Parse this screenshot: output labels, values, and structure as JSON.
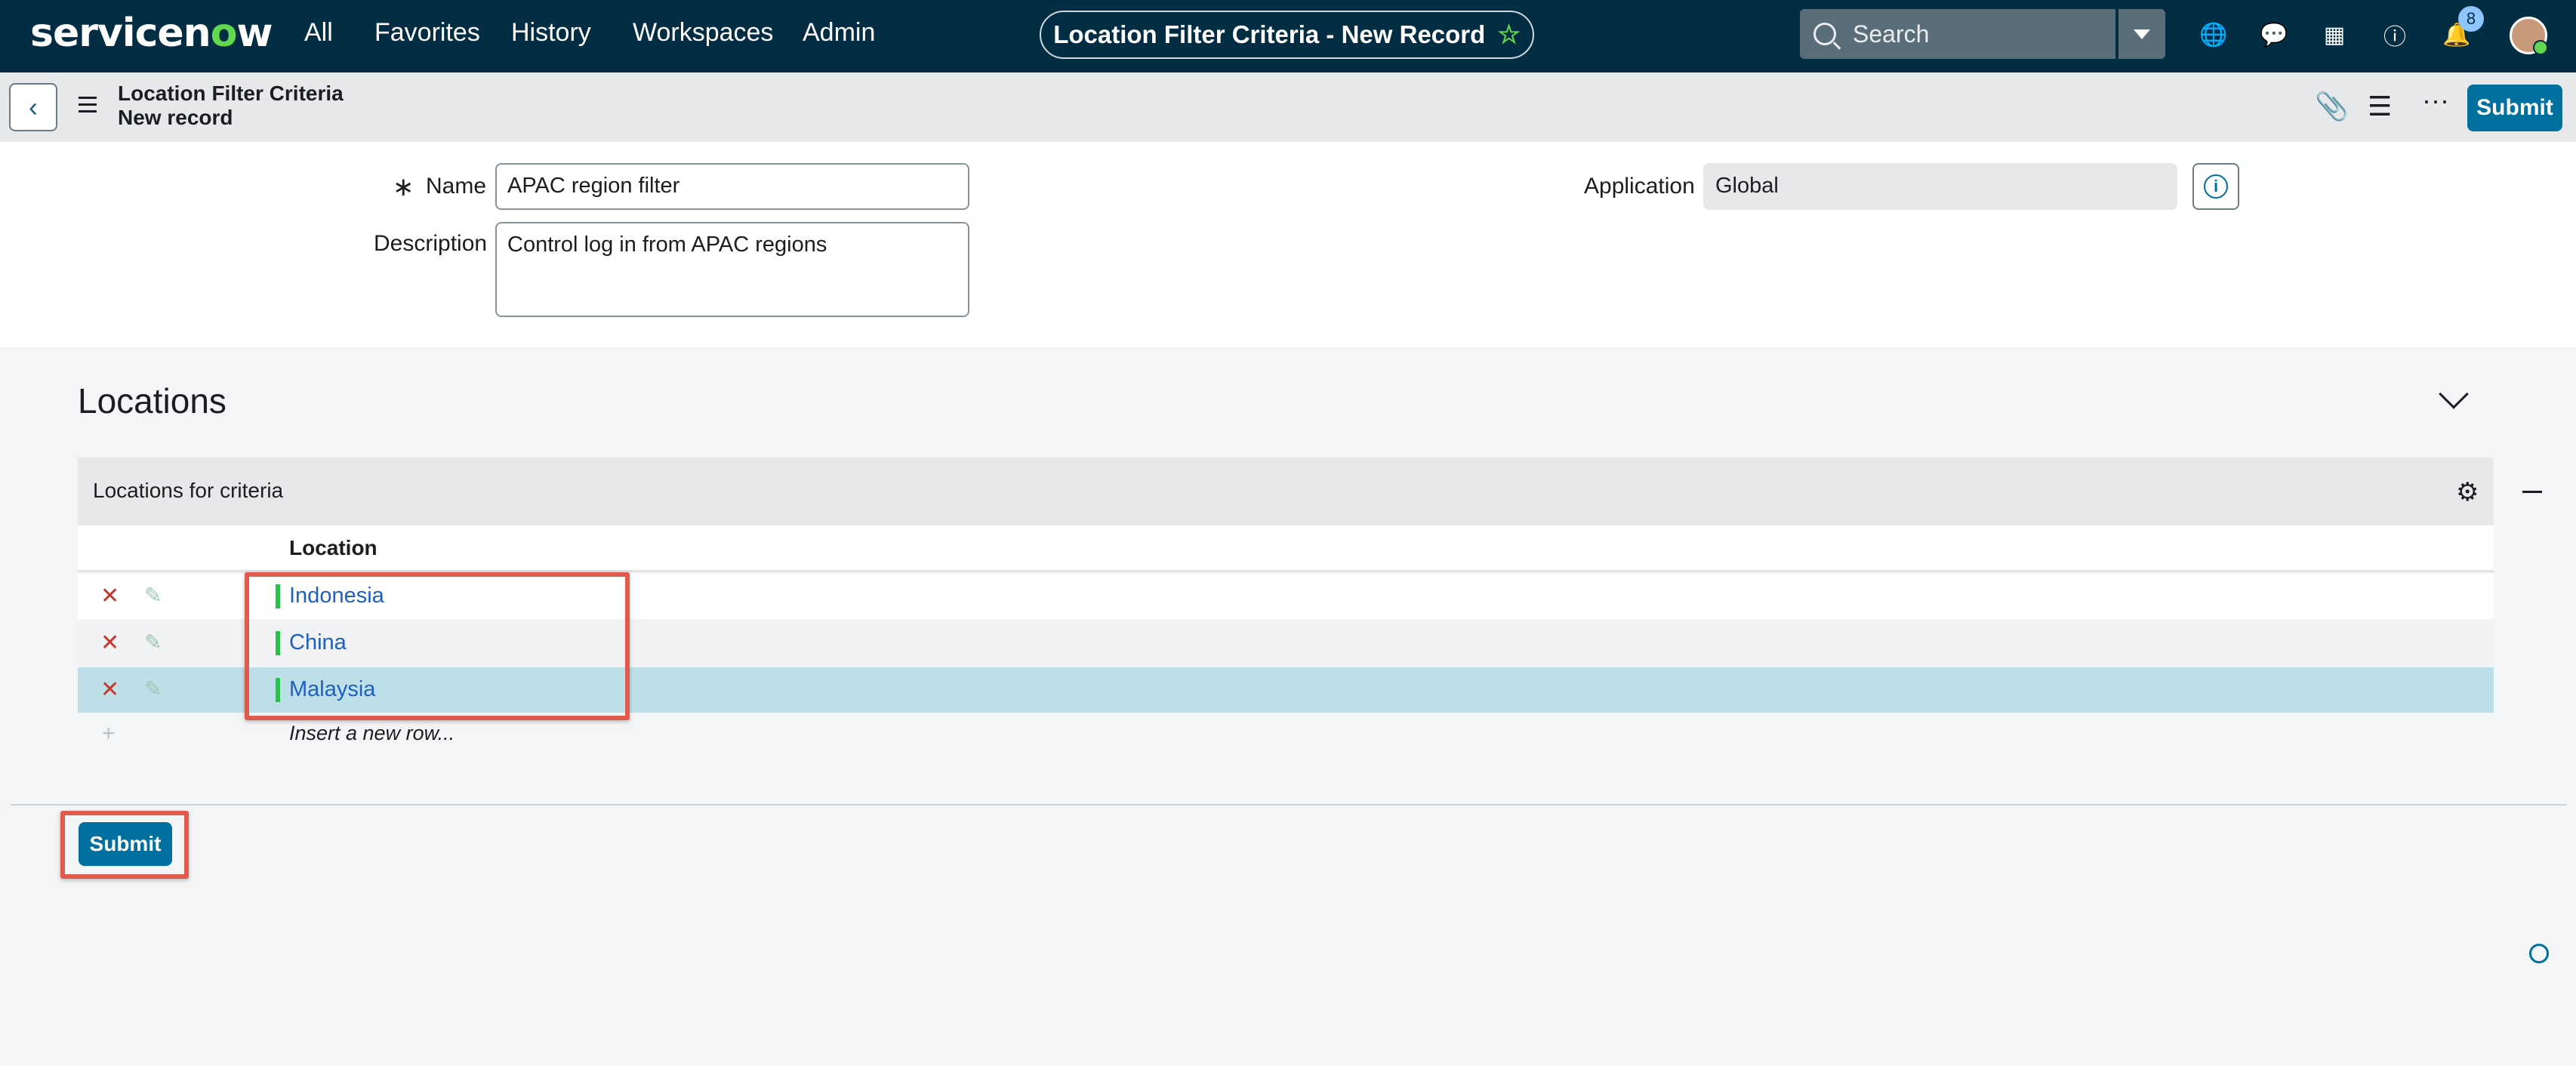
{
  "nav": {
    "logo_pre": "servicen",
    "logo_o": "o",
    "logo_post": "w",
    "items": [
      "All",
      "Favorites",
      "History",
      "Workspaces",
      "Admin"
    ],
    "record_title": "Location Filter Criteria - New Record",
    "search_placeholder": "Search",
    "notification_count": "8"
  },
  "header": {
    "title_line1": "Location Filter Criteria",
    "title_line2": "New record",
    "submit_label": "Submit"
  },
  "form": {
    "name_required_mark": "∗",
    "name_label": "Name",
    "name_value": "APAC region filter",
    "description_label": "Description",
    "description_value": "Control log in from APAC regions",
    "application_label": "Application",
    "application_value": "Global"
  },
  "locations": {
    "section_title": "Locations",
    "list_title": "Locations for criteria",
    "column_header": "Location",
    "rows": [
      "Indonesia",
      "China",
      "Malaysia"
    ],
    "insert_text": "Insert a new row..."
  },
  "footer": {
    "submit_label": "Submit"
  },
  "colors": {
    "nav_bg": "#032d42",
    "accent": "#00719e",
    "highlight": "#e05a4e",
    "selected_row": "#bde0e8"
  }
}
